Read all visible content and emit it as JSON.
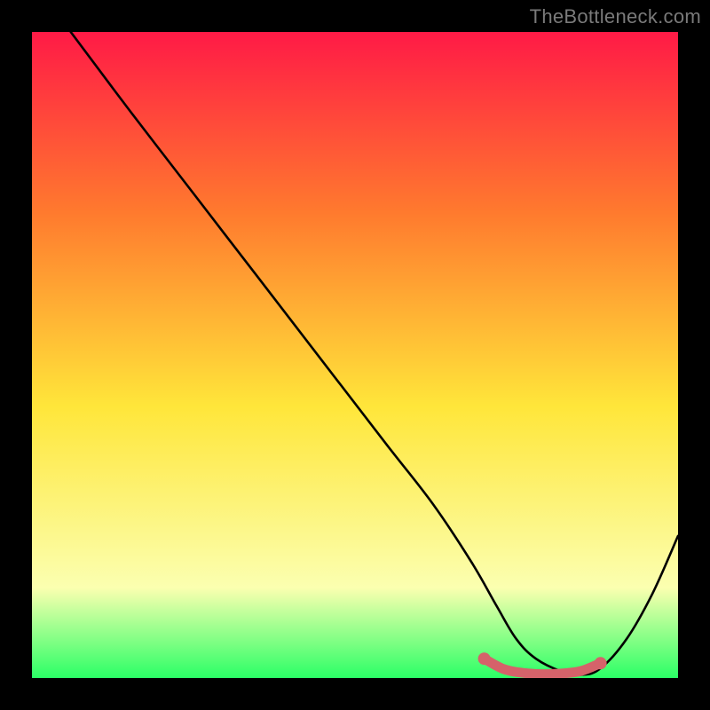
{
  "watermark": "TheBottleneck.com",
  "chart_data": {
    "type": "line",
    "title": "",
    "xlabel": "",
    "ylabel": "",
    "xlim": [
      0,
      100
    ],
    "ylim": [
      0,
      100
    ],
    "grid": false,
    "legend": false,
    "background_gradient": {
      "top": "#ff1a46",
      "mid1": "#ff7a2e",
      "mid2": "#ffe63a",
      "low": "#fbffb0",
      "bottom": "#2bff66"
    },
    "series": [
      {
        "name": "bottleneck-curve",
        "color": "#000000",
        "x": [
          6,
          15,
          25,
          35,
          45,
          55,
          62,
          68,
          72,
          75,
          78,
          82,
          85,
          88,
          92,
          96,
          100
        ],
        "y": [
          100,
          88,
          75,
          62,
          49,
          36,
          27,
          18,
          11,
          6,
          3,
          1,
          0.5,
          1.5,
          6,
          13,
          22
        ]
      },
      {
        "name": "sweet-spot-band",
        "color": "#d5626a",
        "x": [
          70,
          73,
          76,
          79,
          82,
          85,
          88
        ],
        "y": [
          3,
          1.4,
          0.8,
          0.6,
          0.7,
          1.1,
          2.3
        ]
      }
    ]
  }
}
